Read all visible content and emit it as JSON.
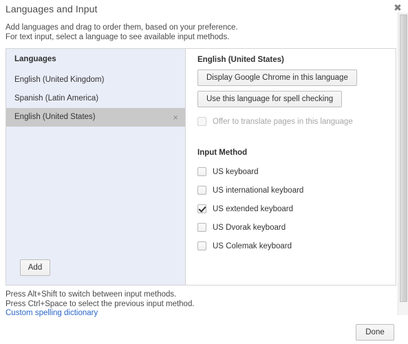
{
  "dialog": {
    "title": "Languages and Input",
    "description": "Add languages and drag to order them, based on your preference.\nFor text input, select a language to see available input methods.",
    "close_label": "✖"
  },
  "left_panel": {
    "header": "Languages",
    "items": [
      {
        "label": "English (United Kingdom)",
        "selected": false,
        "remove_label": ""
      },
      {
        "label": "Spanish (Latin America)",
        "selected": false,
        "remove_label": ""
      },
      {
        "label": "English (United States)",
        "selected": true,
        "remove_label": "×"
      }
    ],
    "add_button": "Add"
  },
  "right_panel": {
    "language_title": "English (United States)",
    "display_chrome_button": "Display Google Chrome in this language",
    "spell_check_button": "Use this language for spell checking",
    "translate_checkbox": {
      "label": "Offer to translate pages in this language",
      "checked": false,
      "disabled": true
    },
    "input_method_title": "Input Method",
    "input_methods": [
      {
        "label": "US keyboard",
        "checked": false
      },
      {
        "label": "US international keyboard",
        "checked": false
      },
      {
        "label": "US extended keyboard",
        "checked": true
      },
      {
        "label": "US Dvorak keyboard",
        "checked": false
      },
      {
        "label": "US Colemak keyboard",
        "checked": false
      }
    ]
  },
  "footer": {
    "hints": "Press Alt+Shift to switch between input methods.\nPress Ctrl+Space to select the previous input method.",
    "dictionary_link": "Custom spelling dictionary",
    "done_button": "Done"
  },
  "colors": {
    "link": "#2a66c8",
    "left_panel_bg": "#e9edf8",
    "selected_row_bg": "#c9c9c9",
    "border": "#d4d4d4"
  }
}
